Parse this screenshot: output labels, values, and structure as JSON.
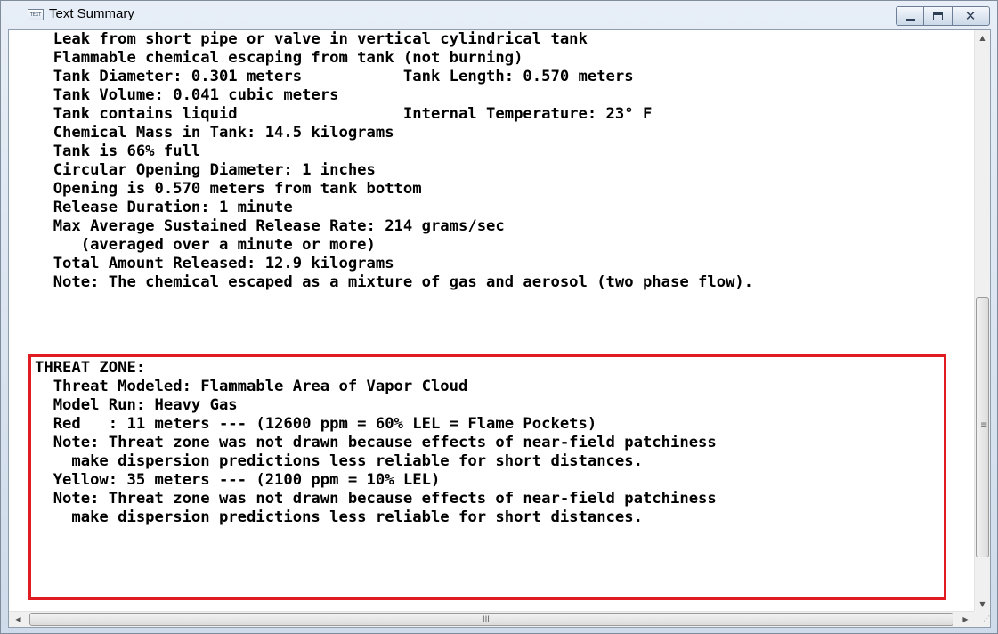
{
  "window": {
    "title": "Text Summary",
    "icon": "text-window-icon",
    "icon_label": "TEXT",
    "controls": {
      "minimize": "minimize-icon",
      "maximize": "maximize-icon",
      "close": "✕"
    }
  },
  "summary_lines": [
    "  Leak from short pipe or valve in vertical cylindrical tank",
    "  Flammable chemical escaping from tank (not burning)",
    "  Tank Diameter: 0.301 meters           Tank Length: 0.570 meters",
    "  Tank Volume: 0.041 cubic meters",
    "  Tank contains liquid                  Internal Temperature: 23° F",
    "  Chemical Mass in Tank: 14.5 kilograms",
    "  Tank is 66% full",
    "  Circular Opening Diameter: 1 inches",
    "  Opening is 0.570 meters from tank bottom",
    "  Release Duration: 1 minute",
    "  Max Average Sustained Release Rate: 214 grams/sec",
    "     (averaged over a minute or more)",
    "  Total Amount Released: 12.9 kilograms",
    "  Note: The chemical escaped as a mixture of gas and aerosol (two phase flow)."
  ],
  "threat_zone_lines": [
    "THREAT ZONE:",
    "  Threat Modeled: Flammable Area of Vapor Cloud",
    "  Model Run: Heavy Gas",
    "  Red   : 11 meters --- (12600 ppm = 60% LEL = Flame Pockets)",
    "  Note: Threat zone was not drawn because effects of near-field patchiness",
    "    make dispersion predictions less reliable for short distances.",
    "  Yellow: 35 meters --- (2100 ppm = 10% LEL)",
    "  Note: Threat zone was not drawn because effects of near-field patchiness",
    "    make dispersion predictions less reliable for short distances."
  ],
  "highlight_color": "#e11b22",
  "scrollbars": {
    "up": "▲",
    "down": "▼",
    "left": "◀",
    "right": "▶",
    "grip_vertical": "≡",
    "grip_horizontal": "III",
    "size_grip": "⋰"
  }
}
